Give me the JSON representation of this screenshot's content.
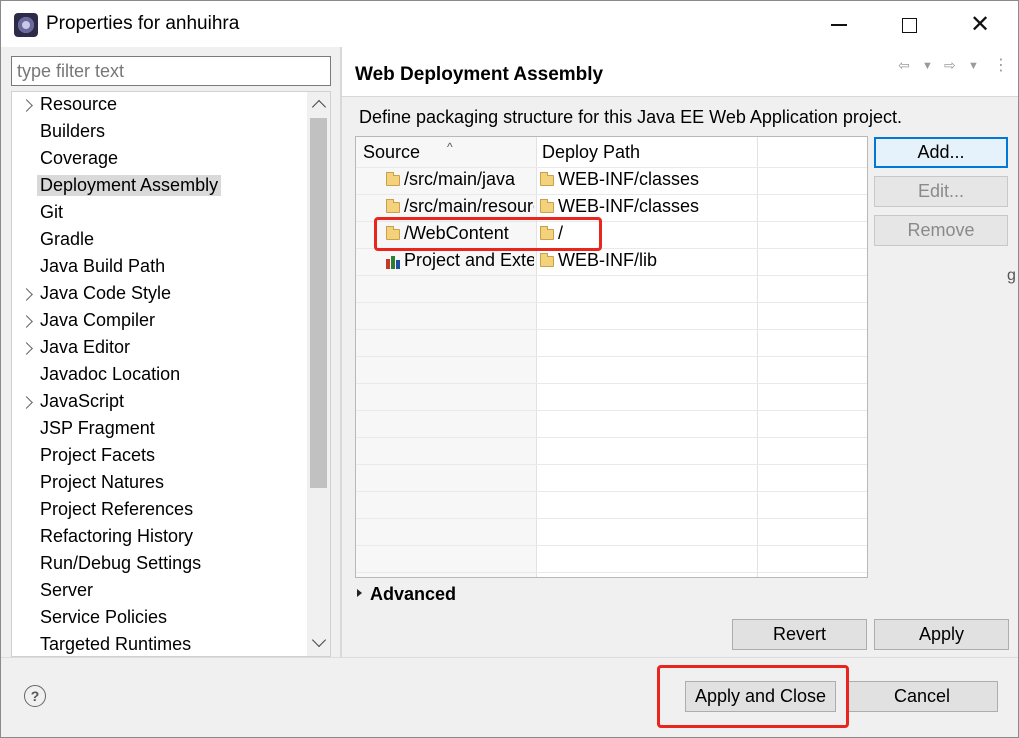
{
  "window": {
    "title": "Properties for anhuihra"
  },
  "filter": {
    "placeholder": "type filter text"
  },
  "tree": {
    "items": [
      {
        "label": "Resource",
        "expandable": true,
        "selected": false
      },
      {
        "label": "Builders",
        "expandable": false,
        "selected": false
      },
      {
        "label": "Coverage",
        "expandable": false,
        "selected": false
      },
      {
        "label": "Deployment Assembly",
        "expandable": false,
        "selected": true
      },
      {
        "label": "Git",
        "expandable": false,
        "selected": false
      },
      {
        "label": "Gradle",
        "expandable": false,
        "selected": false
      },
      {
        "label": "Java Build Path",
        "expandable": false,
        "selected": false
      },
      {
        "label": "Java Code Style",
        "expandable": true,
        "selected": false
      },
      {
        "label": "Java Compiler",
        "expandable": true,
        "selected": false
      },
      {
        "label": "Java Editor",
        "expandable": true,
        "selected": false
      },
      {
        "label": "Javadoc Location",
        "expandable": false,
        "selected": false
      },
      {
        "label": "JavaScript",
        "expandable": true,
        "selected": false
      },
      {
        "label": "JSP Fragment",
        "expandable": false,
        "selected": false
      },
      {
        "label": "Project Facets",
        "expandable": false,
        "selected": false
      },
      {
        "label": "Project Natures",
        "expandable": false,
        "selected": false
      },
      {
        "label": "Project References",
        "expandable": false,
        "selected": false
      },
      {
        "label": "Refactoring History",
        "expandable": false,
        "selected": false
      },
      {
        "label": "Run/Debug Settings",
        "expandable": false,
        "selected": false
      },
      {
        "label": "Server",
        "expandable": false,
        "selected": false
      },
      {
        "label": "Service Policies",
        "expandable": false,
        "selected": false
      },
      {
        "label": "Targeted Runtimes",
        "expandable": false,
        "selected": false
      }
    ]
  },
  "page": {
    "title": "Web Deployment Assembly",
    "description": "Define packaging structure for this Java EE Web Application project."
  },
  "table": {
    "columns": [
      "Source",
      "Deploy Path"
    ],
    "rows": [
      {
        "source": "/src/main/java",
        "deploy": "WEB-INF/classes",
        "source_icon": "folder-icon"
      },
      {
        "source": "/src/main/resources",
        "deploy": "WEB-INF/classes",
        "source_icon": "folder-icon"
      },
      {
        "source": "/WebContent",
        "deploy": "/",
        "source_icon": "folder-icon"
      },
      {
        "source": "Project and External Dependencies",
        "deploy": "WEB-INF/lib",
        "source_icon": "library-icon"
      }
    ]
  },
  "buttons": {
    "add": "Add...",
    "edit": "Edit...",
    "remove": "Remove",
    "revert": "Revert",
    "apply": "Apply",
    "apply_close": "Apply and Close",
    "cancel": "Cancel"
  },
  "advanced": {
    "label": "Advanced"
  },
  "colors": {
    "highlight": "#e8261e",
    "selection": "#d9d9d9",
    "focus_border": "#0078d7"
  }
}
